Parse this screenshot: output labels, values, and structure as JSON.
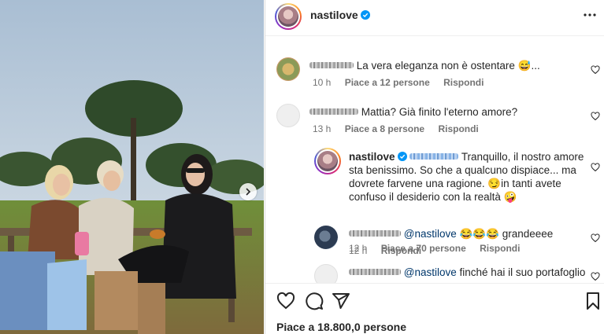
{
  "header": {
    "username": "nastilove"
  },
  "comments": [
    {
      "text": "La vera eleganza non è ostentare 😅...",
      "time": "10 h",
      "likes": "Piace a 12 persone",
      "reply": "Rispondi"
    },
    {
      "text": "Mattia? Già finito l'eterno amore?",
      "time": "13 h",
      "likes": "Piace a 8 persone",
      "reply": "Rispondi"
    },
    {
      "username": "nastilove",
      "text_line1": "Tranquillo, il nostro amore",
      "text_line2": "sta benissimo. So che a qualcuno dispiace... ma",
      "text_line3": "dovrete farvene una ragione. 😏in tanti avete",
      "text_line4": "confuso il desiderio con la realtà 🤪",
      "time": "12 h",
      "likes": "Piace a 70 persone",
      "reply": "Rispondi"
    },
    {
      "mention": "@nastilove",
      "text": "😂😂😂 grandeeee",
      "time": "12 h",
      "reply": "Rispondi"
    },
    {
      "mention": "@nastilove",
      "text": "finché hai il suo portafoglio"
    }
  ],
  "footer": {
    "likes": "Piace a 18.800,0 persone"
  },
  "icons": [
    "heart-icon",
    "comment-icon",
    "share-icon",
    "bookmark-icon",
    "more-icon",
    "verified-icon",
    "chevron-right-icon"
  ]
}
